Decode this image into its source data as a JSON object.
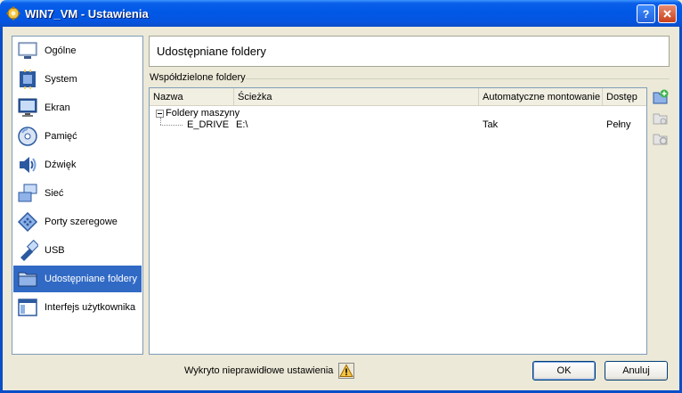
{
  "window": {
    "title": "WIN7_VM - Ustawienia",
    "app_icon": "gear-icon",
    "help_icon": "help-icon",
    "close_icon": "close-icon"
  },
  "sidebar": {
    "items": [
      {
        "label": "Ogólne",
        "icon": "monitor-general-icon"
      },
      {
        "label": "System",
        "icon": "chip-icon"
      },
      {
        "label": "Ekran",
        "icon": "display-icon"
      },
      {
        "label": "Pamięć",
        "icon": "storage-disc-icon"
      },
      {
        "label": "Dźwięk",
        "icon": "speaker-icon"
      },
      {
        "label": "Sieć",
        "icon": "network-icon"
      },
      {
        "label": "Porty szeregowe",
        "icon": "serial-port-icon"
      },
      {
        "label": "USB",
        "icon": "usb-icon"
      },
      {
        "label": "Udostępniane foldery",
        "icon": "shared-folder-icon",
        "selected": true
      },
      {
        "label": "Interfejs użytkownika",
        "icon": "user-interface-icon"
      }
    ]
  },
  "main": {
    "header_title": "Udostępniane foldery",
    "group_label": "Współdzielone foldery",
    "table": {
      "columns": [
        "Nazwa",
        "Ścieżka",
        "Automatyczne montowanie",
        "Dostęp"
      ],
      "group_row": "Foldery maszyny",
      "rows": [
        {
          "name": "E_DRIVE",
          "path": "E:\\",
          "auto_mount": "Tak",
          "access": "Pełny"
        }
      ]
    },
    "tools": [
      "add-folder-icon",
      "edit-folder-icon",
      "remove-folder-icon"
    ]
  },
  "footer": {
    "warning_text": "Wykryto nieprawidłowe ustawienia",
    "warning_icon": "warning-icon",
    "ok_label": "OK",
    "cancel_label": "Anuluj"
  },
  "colors": {
    "titlebar": "#0058e6",
    "selection": "#316ac5",
    "dialog_bg": "#ece9d8"
  }
}
